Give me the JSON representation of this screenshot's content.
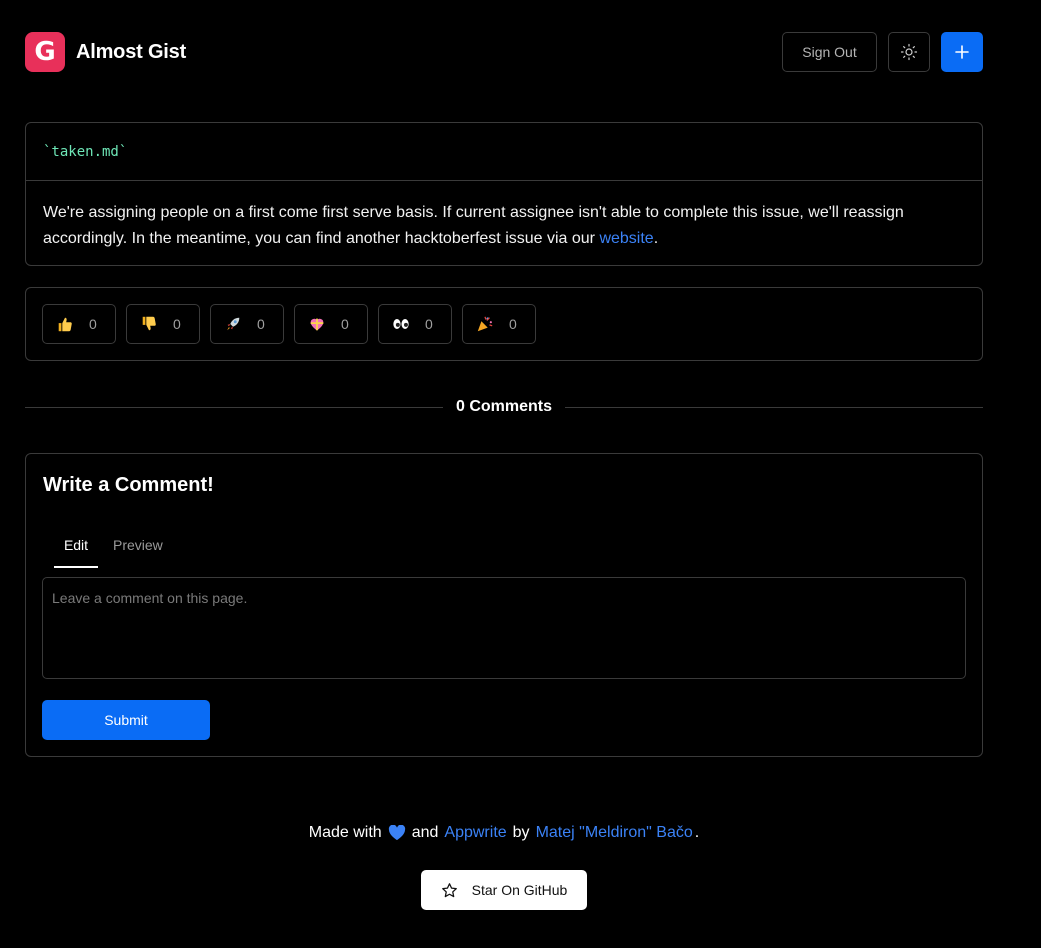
{
  "app": {
    "logo_letter": "G",
    "title": "Almost Gist",
    "brand_color": "#e8305a"
  },
  "header": {
    "sign_out_label": "Sign Out",
    "theme_icon": "sun-icon",
    "new_icon": "plus-icon",
    "accent": "#0a6cf5"
  },
  "gist": {
    "filename": "`taken.md`",
    "body_text": "We're assigning people on a first come first serve basis. If current assignee isn't able to complete this issue, we'll reassign accordingly. In the meantime, you can find another hacktoberfest issue via our ",
    "link_text": "website",
    "body_end": "."
  },
  "reactions": [
    {
      "icon": "thumbs-up-icon",
      "count": "0"
    },
    {
      "icon": "thumbs-down-icon",
      "count": "0"
    },
    {
      "icon": "rocket-icon",
      "count": "0"
    },
    {
      "icon": "heart-gift-icon",
      "count": "0"
    },
    {
      "icon": "eyes-icon",
      "count": "0"
    },
    {
      "icon": "party-popper-icon",
      "count": "0"
    }
  ],
  "comments": {
    "count_label": "0 Comments"
  },
  "comment_form": {
    "title": "Write a Comment!",
    "tabs": [
      "Edit",
      "Preview"
    ],
    "placeholder": "Leave a comment on this page.",
    "submit_label": "Submit"
  },
  "footer": {
    "made_with": "Made with",
    "and": "and",
    "appwrite": "Appwrite",
    "by": "by",
    "author": "Matej \"Meldiron\" Bačo",
    "period": ".",
    "star_label": "Star On GitHub",
    "link_color": "#3b82f6"
  }
}
